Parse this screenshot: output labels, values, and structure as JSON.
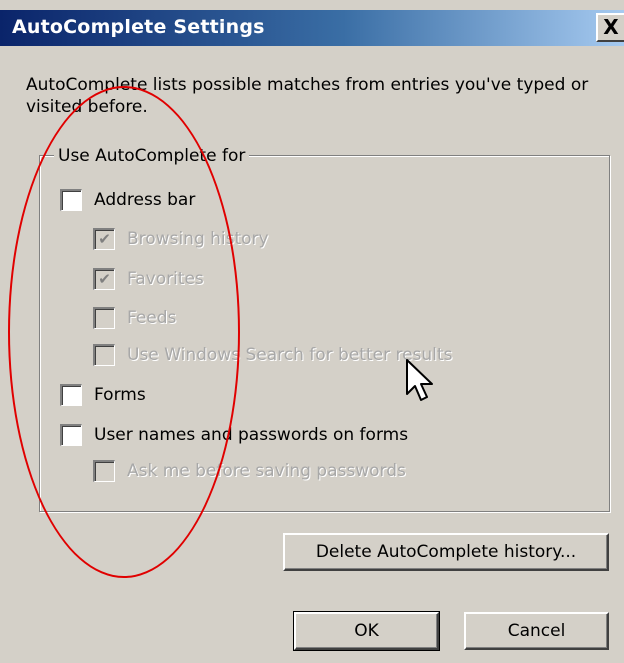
{
  "window": {
    "title": "AutoComplete Settings",
    "close_glyph": "X"
  },
  "description": "AutoComplete lists possible matches from entries you've typed or visited before.",
  "group": {
    "legend": "Use AutoComplete for",
    "options": [
      {
        "label": "Address bar",
        "checked": false,
        "enabled": true
      },
      {
        "label": "Browsing history",
        "checked": true,
        "enabled": false
      },
      {
        "label": "Favorites",
        "checked": true,
        "enabled": false
      },
      {
        "label": "Feeds",
        "checked": false,
        "enabled": false
      },
      {
        "label": "Use Windows Search for better results",
        "checked": false,
        "enabled": false
      },
      {
        "label": "Forms",
        "checked": false,
        "enabled": true
      },
      {
        "label": "User names and passwords on forms",
        "checked": false,
        "enabled": true
      },
      {
        "label": "Ask me before saving passwords",
        "checked": false,
        "enabled": false
      }
    ]
  },
  "buttons": {
    "delete_history": "Delete AutoComplete history...",
    "ok": "OK",
    "cancel": "Cancel"
  },
  "icons": {
    "check_glyph": "✔"
  },
  "colors": {
    "dialog_bg": "#d4d0c8",
    "titlebar_start": "#0a246a",
    "titlebar_end": "#a6caf0",
    "annotation": "#e00000",
    "disabled_text": "#a8a8a8"
  }
}
